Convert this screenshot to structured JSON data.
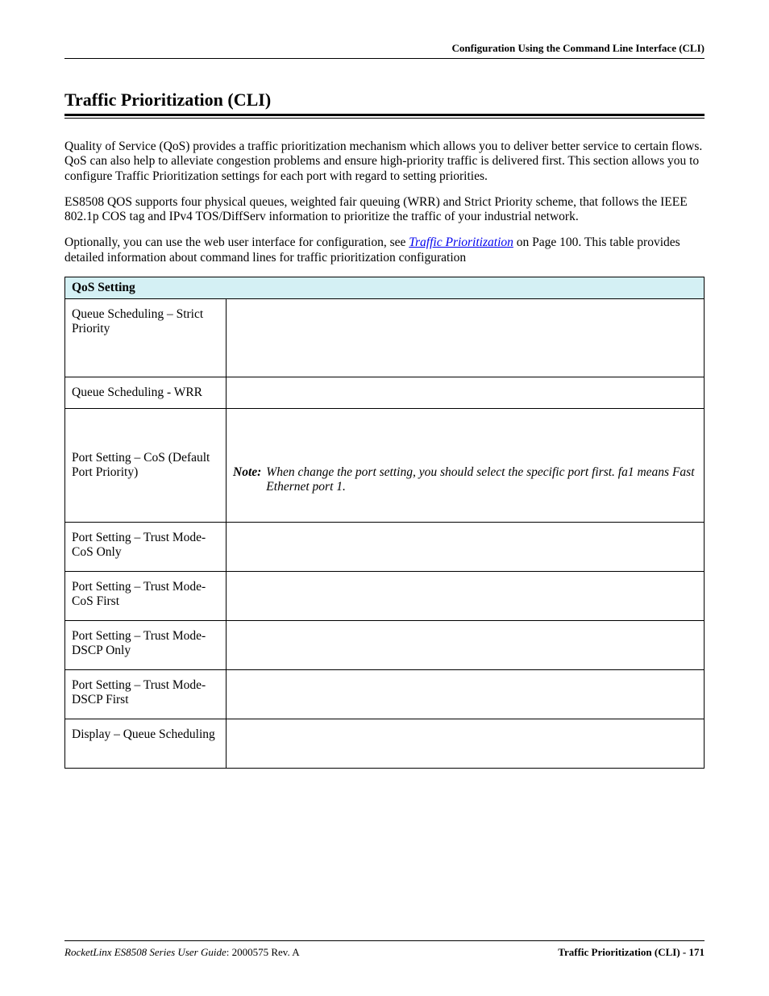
{
  "header": {
    "running_head": "Configuration Using the Command Line Interface (CLI)"
  },
  "title": "Traffic Prioritization (CLI)",
  "paragraphs": {
    "p1": "Quality of Service (QoS) provides a traffic prioritization mechanism which allows you to deliver better service to certain flows. QoS can also help to alleviate congestion problems and ensure high-priority traffic is delivered first. This section allows you to configure Traffic Prioritization settings for each port with regard to setting priorities.",
    "p2": "ES8508 QOS supports four physical queues, weighted fair queuing (WRR) and Strict Priority scheme, that follows the IEEE 802.1p COS tag and IPv4 TOS/DiffServ information to prioritize the traffic of your industrial network.",
    "p3_prefix": "Optionally, you can use the web user interface for configuration, see ",
    "p3_link": "Traffic Prioritization",
    "p3_suffix": " on Page 100. This table provides detailed information about command lines for traffic prioritization configuration"
  },
  "table": {
    "header": "QoS Setting",
    "rows": [
      {
        "label": "Queue Scheduling – Strict Priority",
        "note": null
      },
      {
        "label": "Queue Scheduling - WRR",
        "note": null
      },
      {
        "label": "Port Setting – CoS (Default Port Priority)",
        "note": {
          "label": "Note:",
          "text": "When change the port setting, you should select the specific port first. fa1 means Fast Ethernet port 1."
        }
      },
      {
        "label": "Port Setting – Trust Mode- CoS Only",
        "note": null
      },
      {
        "label": "Port Setting – Trust Mode- CoS First",
        "note": null
      },
      {
        "label": "Port Setting – Trust Mode- DSCP Only",
        "note": null
      },
      {
        "label": "Port Setting – Trust Mode- DSCP First",
        "note": null
      },
      {
        "label": "Display – Queue Scheduling",
        "note": null
      }
    ]
  },
  "footer": {
    "product": "RocketLinx ES8508 Series  User Guide",
    "doc_rev": ": 2000575 Rev. A",
    "page_label": "Traffic Prioritization (CLI) - 171"
  }
}
